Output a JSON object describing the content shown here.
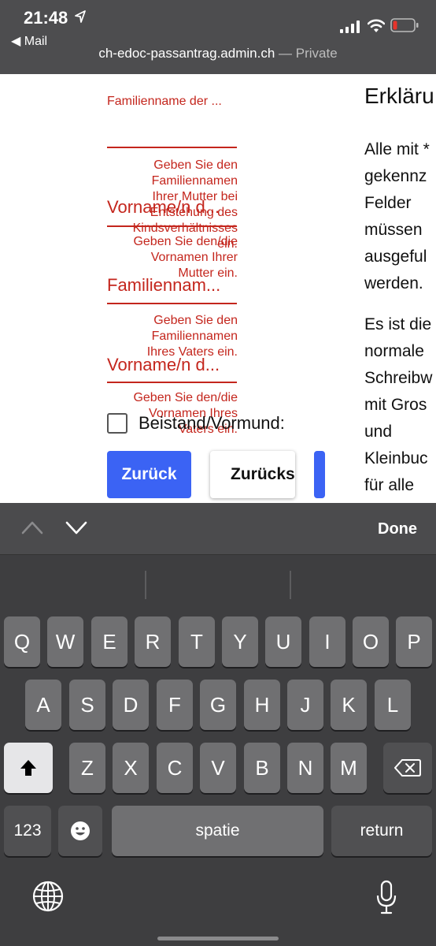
{
  "status": {
    "time": "21:48",
    "back_app": "◀ Mail"
  },
  "browser": {
    "domain": "ch-edoc-passantrag.admin.ch",
    "private_label": " — Private"
  },
  "form": {
    "mother_surname_label": "Familienname der ...",
    "mother_surname_error": [
      "Geben Sie den",
      "Familiennamen",
      "Ihrer Mutter bei",
      "Entstehung des",
      "Kindsverhältnisses",
      "ein."
    ],
    "mother_firstname_label": "Vorname/n d...",
    "mother_firstname_error": [
      "Geben Sie den/die",
      "Vornamen Ihrer",
      "Mutter ein."
    ],
    "father_surname_label": "Familiennam...",
    "father_surname_error": [
      "Geben Sie den",
      "Familiennamen",
      "Ihres Vaters ein."
    ],
    "father_firstname_label": "Vorname/n d...",
    "father_firstname_error": [
      "Geben Sie den/die",
      "Vornamen Ihres",
      "Vaters ein."
    ],
    "guardian_label": "Beistand/Vormund:",
    "btn_back": "Zurück",
    "btn_reset": "Zurücks"
  },
  "declaration": {
    "title": "Erkläru",
    "para1": [
      "Alle mit *",
      "gekennz",
      "Felder",
      "müssen",
      "ausgeful",
      "werden."
    ],
    "para2": [
      "Es ist die",
      "normale",
      "Schreibw",
      "mit Gros",
      "und",
      "Kleinbuc",
      "für alle"
    ]
  },
  "accessory": {
    "done": "Done"
  },
  "keyboard": {
    "row1": [
      "Q",
      "W",
      "E",
      "R",
      "T",
      "Y",
      "U",
      "I",
      "O",
      "P"
    ],
    "row2": [
      "A",
      "S",
      "D",
      "F",
      "G",
      "H",
      "J",
      "K",
      "L"
    ],
    "row3": [
      "Z",
      "X",
      "C",
      "V",
      "B",
      "N",
      "M"
    ],
    "numbers_key": "123",
    "space_key": "spatie",
    "return_key": "return"
  },
  "colors": {
    "error_red": "#c4261d",
    "primary_blue": "#3b63f4",
    "battery_low": "#e8342b"
  }
}
